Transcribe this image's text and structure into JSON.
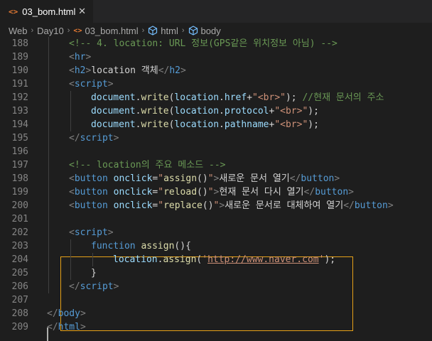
{
  "tab": {
    "icon": "<>",
    "title": "03_bom.html",
    "close": "✕"
  },
  "breadcrumb": [
    "Web",
    "Day10",
    "03_bom.html",
    "html",
    "body"
  ],
  "breadcrumb_file_icon": "<>",
  "lines": [
    {
      "n": "188",
      "indent": 1,
      "tokens": [
        [
          "c",
          "<!-- 4. location: URL 정보(GPS같은 위치정보 아님) -->"
        ]
      ]
    },
    {
      "n": "189",
      "indent": 1,
      "tokens": [
        [
          "p",
          "<"
        ],
        [
          "t",
          "hr"
        ],
        [
          "p",
          ">"
        ]
      ]
    },
    {
      "n": "190",
      "indent": 1,
      "tokens": [
        [
          "p",
          "<"
        ],
        [
          "t",
          "h2"
        ],
        [
          "p",
          ">"
        ],
        [
          "w",
          "location 객체"
        ],
        [
          "p",
          "</"
        ],
        [
          "t",
          "h2"
        ],
        [
          "p",
          ">"
        ]
      ]
    },
    {
      "n": "191",
      "indent": 1,
      "tokens": [
        [
          "p",
          "<"
        ],
        [
          "t",
          "script"
        ],
        [
          "p",
          ">"
        ]
      ]
    },
    {
      "n": "192",
      "indent": 2,
      "tokens": [
        [
          "a",
          "document"
        ],
        [
          "w",
          "."
        ],
        [
          "f",
          "write"
        ],
        [
          "w",
          "("
        ],
        [
          "a",
          "location"
        ],
        [
          "w",
          "."
        ],
        [
          "a",
          "href"
        ],
        [
          "w",
          "+"
        ],
        [
          "s",
          "\"<br>\""
        ],
        [
          "w",
          "); "
        ],
        [
          "c",
          "//현재 문서의 주소"
        ]
      ]
    },
    {
      "n": "193",
      "indent": 2,
      "tokens": [
        [
          "a",
          "document"
        ],
        [
          "w",
          "."
        ],
        [
          "f",
          "write"
        ],
        [
          "w",
          "("
        ],
        [
          "a",
          "location"
        ],
        [
          "w",
          "."
        ],
        [
          "a",
          "protocol"
        ],
        [
          "w",
          "+"
        ],
        [
          "s",
          "\"<br>\""
        ],
        [
          "w",
          ");"
        ]
      ]
    },
    {
      "n": "194",
      "indent": 2,
      "tokens": [
        [
          "a",
          "document"
        ],
        [
          "w",
          "."
        ],
        [
          "f",
          "write"
        ],
        [
          "w",
          "("
        ],
        [
          "a",
          "location"
        ],
        [
          "w",
          "."
        ],
        [
          "a",
          "pathname"
        ],
        [
          "w",
          "+"
        ],
        [
          "s",
          "\"<br>\""
        ],
        [
          "w",
          ");"
        ]
      ]
    },
    {
      "n": "195",
      "indent": 1,
      "tokens": [
        [
          "p",
          "</"
        ],
        [
          "t",
          "script"
        ],
        [
          "p",
          ">"
        ]
      ]
    },
    {
      "n": "196",
      "indent": 0,
      "tokens": []
    },
    {
      "n": "197",
      "indent": 1,
      "tokens": [
        [
          "c",
          "<!-- location의 주요 메소드 -->"
        ]
      ]
    },
    {
      "n": "198",
      "indent": 1,
      "tokens": [
        [
          "p",
          "<"
        ],
        [
          "t",
          "button"
        ],
        [
          "w",
          " "
        ],
        [
          "a",
          "onclick"
        ],
        [
          "w",
          "="
        ],
        [
          "s",
          "\""
        ],
        [
          "f",
          "assign"
        ],
        [
          "w",
          "()"
        ],
        [
          "s",
          "\""
        ],
        [
          "p",
          ">"
        ],
        [
          "w",
          "새로운 문서 열기"
        ],
        [
          "p",
          "</"
        ],
        [
          "t",
          "button"
        ],
        [
          "p",
          ">"
        ]
      ]
    },
    {
      "n": "199",
      "indent": 1,
      "tokens": [
        [
          "p",
          "<"
        ],
        [
          "t",
          "button"
        ],
        [
          "w",
          " "
        ],
        [
          "a",
          "onclick"
        ],
        [
          "w",
          "="
        ],
        [
          "s",
          "\""
        ],
        [
          "f",
          "reload"
        ],
        [
          "w",
          "()"
        ],
        [
          "s",
          "\""
        ],
        [
          "p",
          ">"
        ],
        [
          "w",
          "현재 문서 다시 열기"
        ],
        [
          "p",
          "</"
        ],
        [
          "t",
          "button"
        ],
        [
          "p",
          ">"
        ]
      ]
    },
    {
      "n": "200",
      "indent": 1,
      "tokens": [
        [
          "p",
          "<"
        ],
        [
          "t",
          "button"
        ],
        [
          "w",
          " "
        ],
        [
          "a",
          "onclick"
        ],
        [
          "w",
          "="
        ],
        [
          "s",
          "\""
        ],
        [
          "f",
          "replace"
        ],
        [
          "w",
          "()"
        ],
        [
          "s",
          "\""
        ],
        [
          "p",
          ">"
        ],
        [
          "w",
          "새로운 문서로 대체하여 열기"
        ],
        [
          "p",
          "</"
        ],
        [
          "t",
          "button"
        ],
        [
          "p",
          ">"
        ]
      ]
    },
    {
      "n": "201",
      "indent": 0,
      "tokens": []
    },
    {
      "n": "202",
      "indent": 1,
      "tokens": [
        [
          "p",
          "<"
        ],
        [
          "t",
          "script"
        ],
        [
          "p",
          ">"
        ]
      ]
    },
    {
      "n": "203",
      "indent": 2,
      "tokens": [
        [
          "k",
          "function"
        ],
        [
          "w",
          " "
        ],
        [
          "f",
          "assign"
        ],
        [
          "w",
          "(){"
        ]
      ]
    },
    {
      "n": "204",
      "indent": 3,
      "tokens": [
        [
          "a",
          "location"
        ],
        [
          "w",
          "."
        ],
        [
          "f",
          "assign"
        ],
        [
          "w",
          "("
        ],
        [
          "s",
          "'"
        ],
        [
          "url",
          "http://www.naver.com"
        ],
        [
          "s",
          "'"
        ],
        [
          "w",
          ");"
        ]
      ]
    },
    {
      "n": "205",
      "indent": 2,
      "tokens": [
        [
          "w",
          "}"
        ]
      ]
    },
    {
      "n": "206",
      "indent": 1,
      "tokens": [
        [
          "p",
          "</"
        ],
        [
          "t",
          "script"
        ],
        [
          "p",
          ">"
        ]
      ]
    },
    {
      "n": "207",
      "indent": 0,
      "tokens": []
    },
    {
      "n": "208",
      "indent": 0,
      "tokens": [
        [
          "p",
          "</"
        ],
        [
          "t",
          "body"
        ],
        [
          "p",
          ">"
        ]
      ]
    },
    {
      "n": "209",
      "indent": 0,
      "tokens": [
        [
          "p",
          "</"
        ],
        [
          "t",
          "html"
        ],
        [
          "p",
          ">"
        ]
      ]
    }
  ]
}
